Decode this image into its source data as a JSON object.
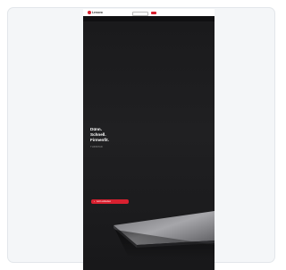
{
  "card": {},
  "header": {
    "logo_text": "Lenovo",
    "top_links": [
      "",
      "",
      ""
    ],
    "main_nav": [
      "",
      "",
      "",
      "",
      "",
      ""
    ]
  },
  "hero": {
    "title_lines": [
      "Dünn.",
      "Schnell.",
      "Firmenfit."
    ],
    "subtitle": "THINKPAD",
    "cta_label": "Jetzt entdecken",
    "cta_icon": "arrow-icon"
  },
  "colors": {
    "accent": "#d8202f",
    "hero_bg": "#1c1c1e",
    "card_bg": "#f4f6f8"
  }
}
